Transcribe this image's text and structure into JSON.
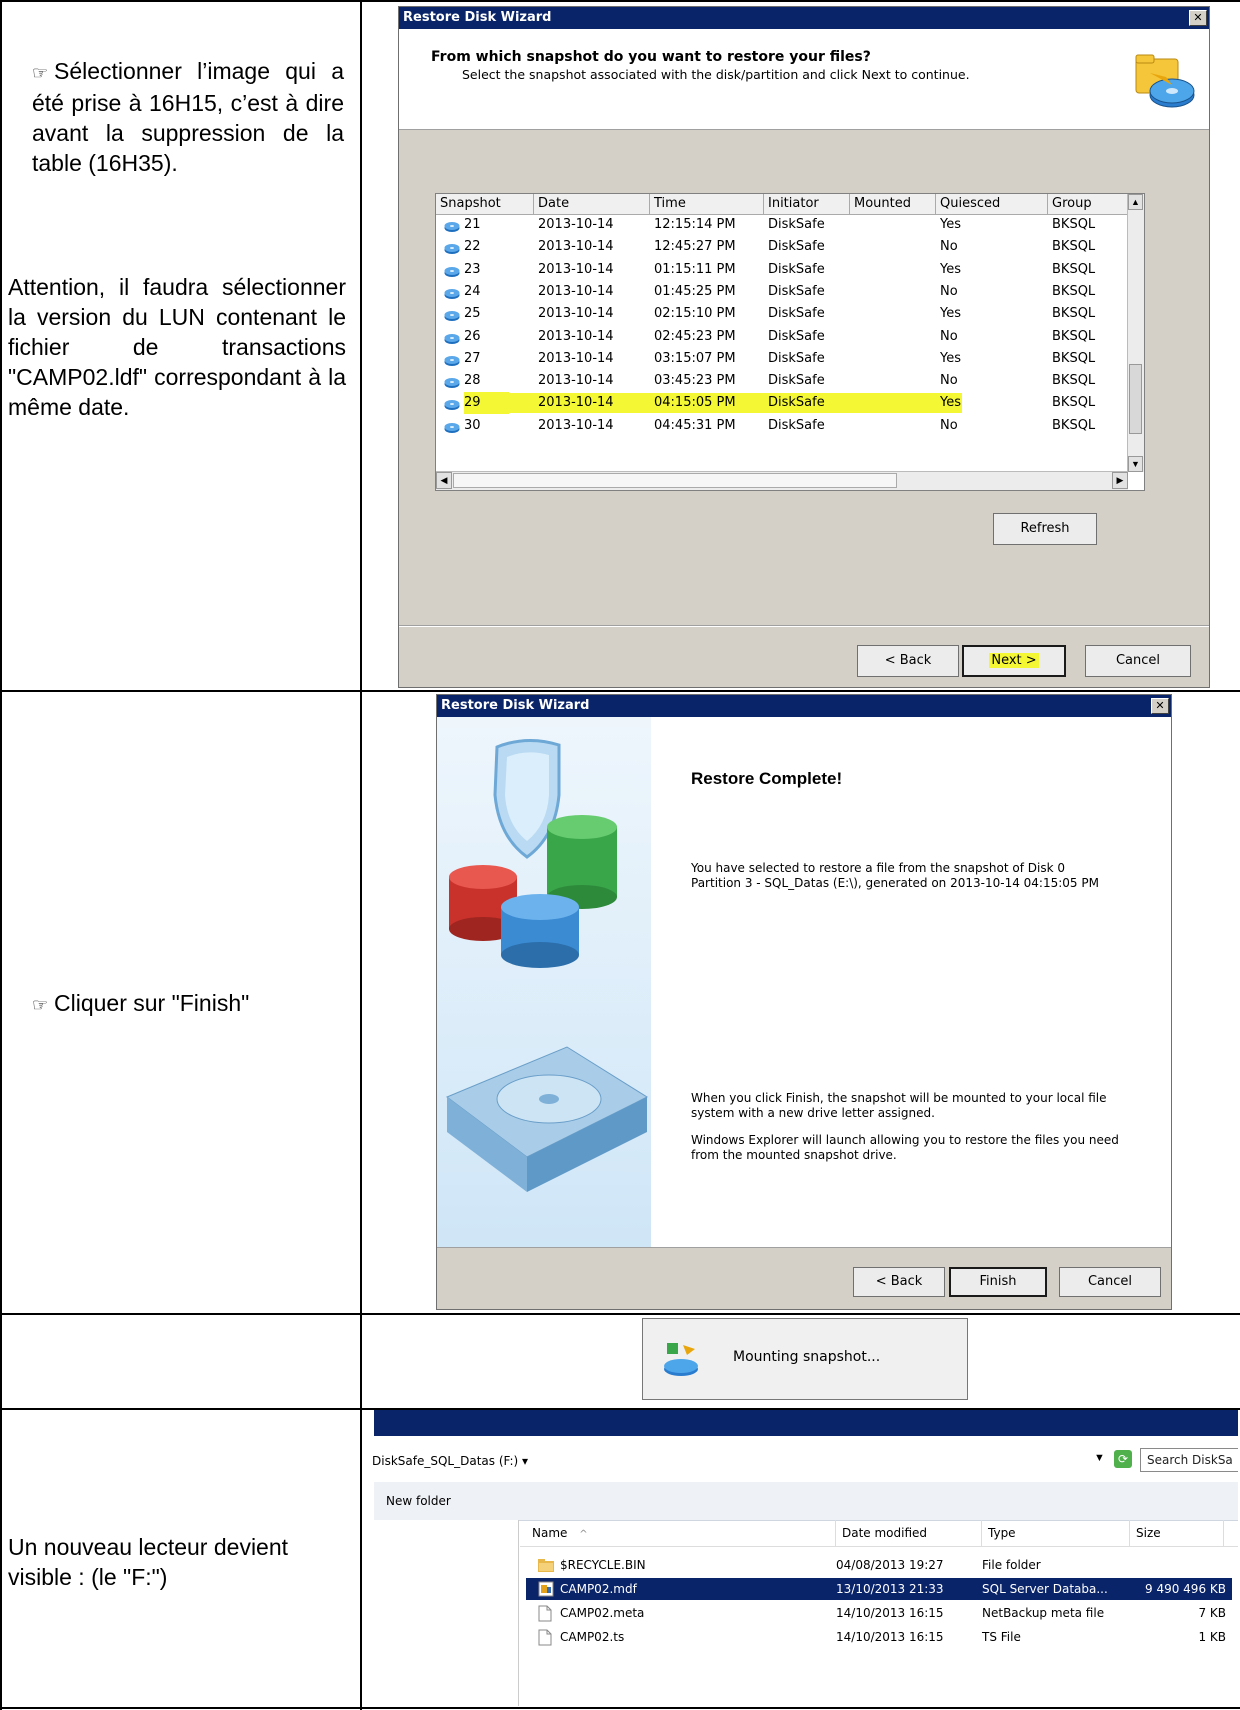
{
  "notes": {
    "row1_bullet": "☞",
    "row1_text": "Sélectionner l’image qui a été prise à 16H15, c’est à dire avant la suppression de la table (16H35).",
    "row1_warning": "Attention, il faudra sélectionner la version du LUN contenant le fichier de transactions \"CAMP02.ldf\" correspondant à la même date.",
    "row2_bullet": "☞",
    "row2_text": "Cliquer sur \"Finish\"",
    "row4_text": "Un nouveau lecteur devient visible : (le \"F:\")"
  },
  "wizard1": {
    "title": "Restore Disk Wizard",
    "close": "✕",
    "heading": "From which snapshot do you want to restore your files?",
    "subheading": "Select the snapshot associated with the disk/partition and click Next to continue.",
    "columns": [
      "Snapshot",
      "Date",
      "Time",
      "Initiator",
      "Mounted",
      "Quiesced",
      "Group"
    ],
    "rows": [
      {
        "snapshot": "21",
        "date": "2013-10-14",
        "time": "12:15:14 PM",
        "initiator": "DiskSafe",
        "mounted": "",
        "quiesced": "Yes",
        "group": "BKSQL",
        "highlight": false
      },
      {
        "snapshot": "22",
        "date": "2013-10-14",
        "time": "12:45:27 PM",
        "initiator": "DiskSafe",
        "mounted": "",
        "quiesced": "No",
        "group": "BKSQL",
        "highlight": false
      },
      {
        "snapshot": "23",
        "date": "2013-10-14",
        "time": "01:15:11 PM",
        "initiator": "DiskSafe",
        "mounted": "",
        "quiesced": "Yes",
        "group": "BKSQL",
        "highlight": false
      },
      {
        "snapshot": "24",
        "date": "2013-10-14",
        "time": "01:45:25 PM",
        "initiator": "DiskSafe",
        "mounted": "",
        "quiesced": "No",
        "group": "BKSQL",
        "highlight": false
      },
      {
        "snapshot": "25",
        "date": "2013-10-14",
        "time": "02:15:10 PM",
        "initiator": "DiskSafe",
        "mounted": "",
        "quiesced": "Yes",
        "group": "BKSQL",
        "highlight": false
      },
      {
        "snapshot": "26",
        "date": "2013-10-14",
        "time": "02:45:23 PM",
        "initiator": "DiskSafe",
        "mounted": "",
        "quiesced": "No",
        "group": "BKSQL",
        "highlight": false
      },
      {
        "snapshot": "27",
        "date": "2013-10-14",
        "time": "03:15:07 PM",
        "initiator": "DiskSafe",
        "mounted": "",
        "quiesced": "Yes",
        "group": "BKSQL",
        "highlight": false
      },
      {
        "snapshot": "28",
        "date": "2013-10-14",
        "time": "03:45:23 PM",
        "initiator": "DiskSafe",
        "mounted": "",
        "quiesced": "No",
        "group": "BKSQL",
        "highlight": false
      },
      {
        "snapshot": "29",
        "date": "2013-10-14",
        "time": "04:15:05 PM",
        "initiator": "DiskSafe",
        "mounted": "",
        "quiesced": "Yes",
        "group": "BKSQL",
        "highlight": true
      },
      {
        "snapshot": "30",
        "date": "2013-10-14",
        "time": "04:45:31 PM",
        "initiator": "DiskSafe",
        "mounted": "",
        "quiesced": "No",
        "group": "BKSQL",
        "highlight": false
      }
    ],
    "refresh": "Refresh",
    "back": "< Back",
    "next": "Next >",
    "cancel": "Cancel",
    "highlight_color": "#f4f733"
  },
  "wizard2": {
    "title": "Restore Disk Wizard",
    "close": "✕",
    "heading": "Restore Complete!",
    "body1": "You have selected to restore a file from the snapshot of Disk 0 Partition 3 - SQL_Datas (E:\\), generated on 2013-10-14 04:15:05 PM",
    "body2": "When you click Finish, the snapshot will be mounted to your local file system with a new drive letter assigned.",
    "body3": "Windows Explorer will launch allowing you to restore the files you need from the mounted snapshot drive.",
    "back": "< Back",
    "finish": "Finish",
    "cancel": "Cancel"
  },
  "mounting": {
    "text": "Mounting snapshot..."
  },
  "explorer": {
    "path": "DiskSafe_SQL_Datas (F:) ▾",
    "search_placeholder": "Search DiskSa",
    "new_folder": "New folder",
    "columns": [
      "Name",
      "Date modified",
      "Type",
      "Size"
    ],
    "sort_indicator": "^",
    "files": [
      {
        "name": "$RECYCLE.BIN",
        "date": "04/08/2013 19:27",
        "type": "File folder",
        "size": "",
        "icon": "folder-icon",
        "selected": false
      },
      {
        "name": "CAMP02.mdf",
        "date": "13/10/2013 21:33",
        "type": "SQL Server Databa...",
        "size": "9 490 496 KB",
        "icon": "database-file-icon",
        "selected": true
      },
      {
        "name": "CAMP02.meta",
        "date": "14/10/2013 16:15",
        "type": "NetBackup meta file",
        "size": "7 KB",
        "icon": "file-icon",
        "selected": false
      },
      {
        "name": "CAMP02.ts",
        "date": "14/10/2013 16:15",
        "type": "TS File",
        "size": "1 KB",
        "icon": "file-icon",
        "selected": false
      }
    ]
  }
}
